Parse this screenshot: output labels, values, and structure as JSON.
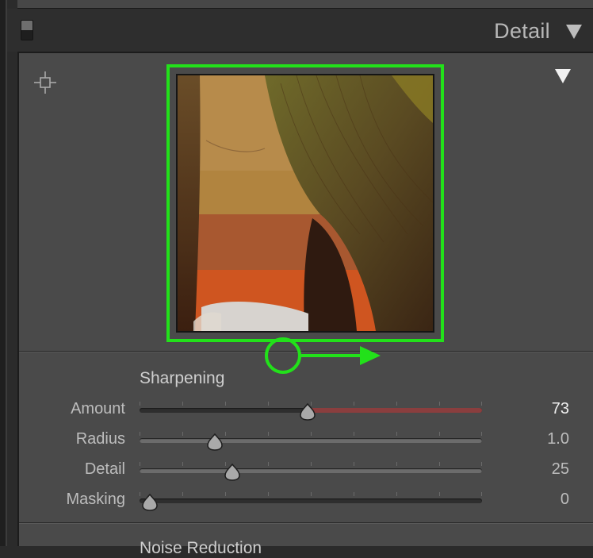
{
  "panel": {
    "title": "Detail"
  },
  "sharpening": {
    "heading": "Sharpening",
    "sliders": [
      {
        "label": "Amount",
        "value": "73",
        "position": 0.49
      },
      {
        "label": "Radius",
        "value": "1.0",
        "position": 0.22
      },
      {
        "label": "Detail",
        "value": "25",
        "position": 0.27
      },
      {
        "label": "Masking",
        "value": "0",
        "position": 0.03
      }
    ]
  },
  "next_section": {
    "heading": "Noise Reduction"
  },
  "colors": {
    "highlight": "#22e11a",
    "panel_bg": "#4a4a4a",
    "active_fill": "#8a3e3e"
  },
  "icons": {
    "panel_switch": "panel-toggle-switch-icon",
    "collapse": "triangle-down-icon",
    "target": "crosshair-target-icon",
    "preview_toggle": "triangle-down-icon",
    "thumb": "slider-thumb-icon"
  }
}
